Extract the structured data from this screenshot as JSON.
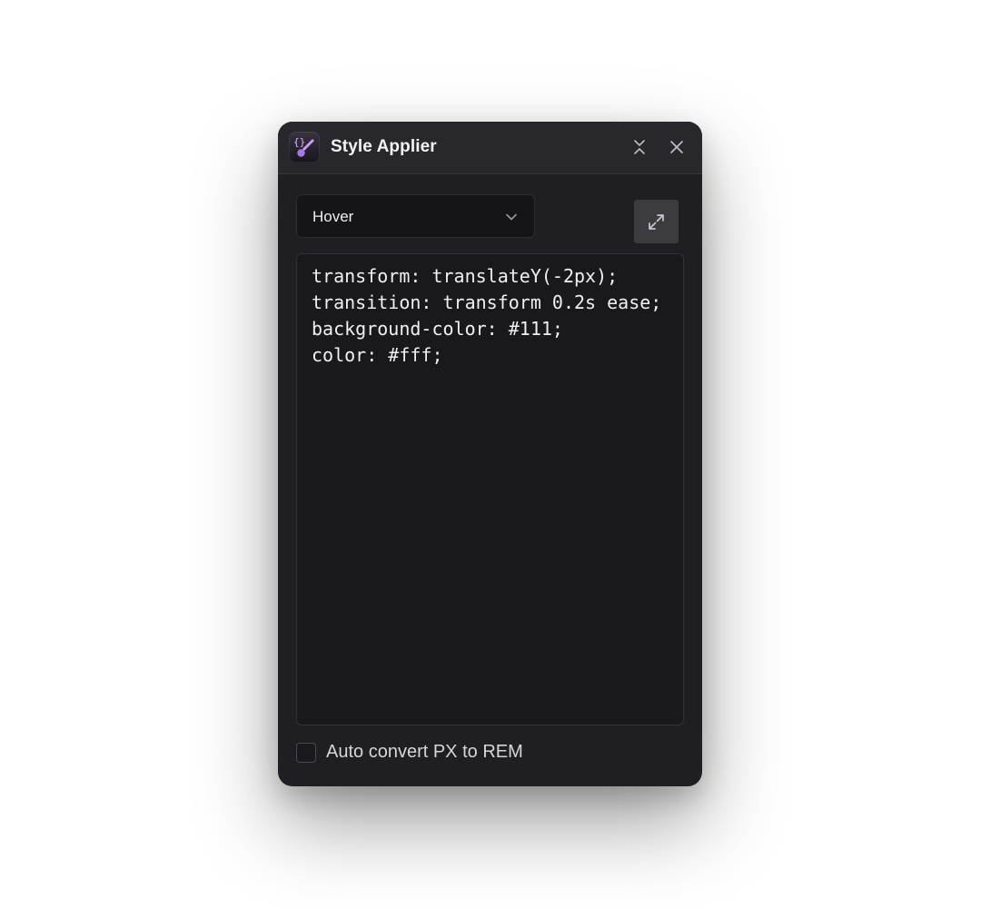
{
  "window": {
    "title": "Style Applier",
    "app_icon": "code-brush-icon",
    "buttons": {
      "collapse_icon": "collapse-icon",
      "close_icon": "close-icon"
    }
  },
  "state_select": {
    "selected": "Hover",
    "icon": "chevron-down-icon"
  },
  "expand_button": {
    "icon": "expand-icon"
  },
  "editor": {
    "lines": [
      "transform: translateY(-2px);",
      "transition: transform 0.2s ease;",
      "background-color: #111;",
      "color: #fff;"
    ]
  },
  "options": {
    "auto_convert_label": "Auto convert PX to REM",
    "auto_convert_checked": false
  },
  "colors": {
    "panel_bg": "#1f1e22",
    "header_bg": "#28272b",
    "editor_bg": "#19181b",
    "accent": "#a879e6"
  }
}
